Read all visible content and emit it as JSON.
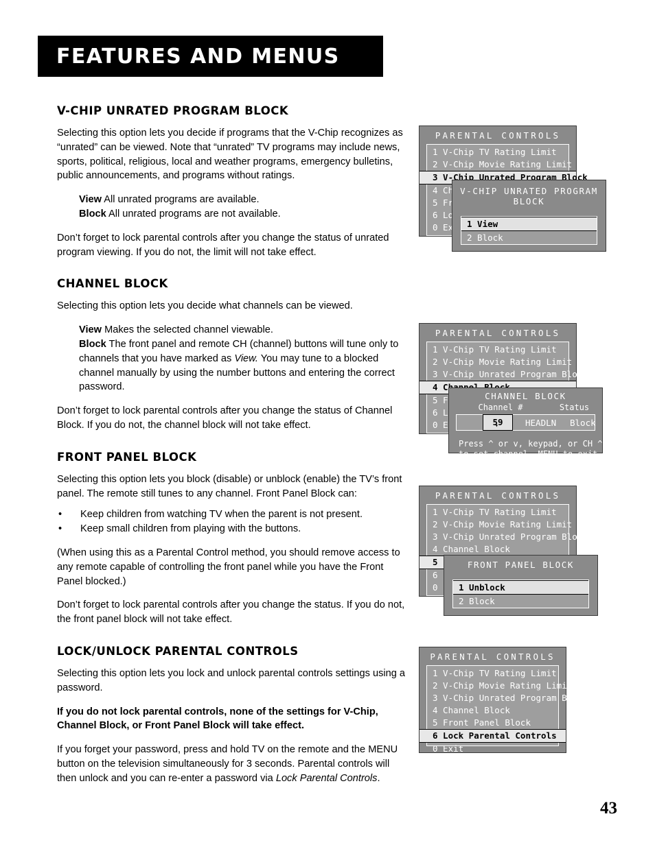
{
  "header": {
    "title": "FEATURES AND MENUS"
  },
  "page": {
    "number": "43"
  },
  "sections": {
    "vchip_unrated": {
      "heading": "V-CHIP UNRATED PROGRAM BLOCK",
      "intro": "Selecting this option lets you decide if programs that the V-Chip recognizes as “unrated” can be viewed. Note that “unrated” TV  programs may include news, sports, political, religious, local and weather programs, emergency bulletins, public announcements, and programs without ratings.",
      "view_term": "View",
      "view_desc": "All unrated programs are available.",
      "block_term": "Block",
      "block_desc": "All unrated programs are not available.",
      "outro": "Don’t forget to lock parental controls after you change the status of unrated program viewing. If you do not, the limit will not take effect."
    },
    "channel_block": {
      "heading": "CHANNEL BLOCK",
      "intro": "Selecting this option lets you decide what channels can be viewed.",
      "view_term": "View",
      "view_desc": "Makes the selected channel viewable.",
      "block_term": "Block",
      "block_desc_1": "The front panel and remote CH (channel) buttons will tune only to channels that you have marked as ",
      "block_desc_em": "View.",
      "block_desc_2": "  You may tune to a blocked channel manually by using the number buttons and entering the correct password.",
      "outro": "Don’t forget to lock parental controls after you change the status of Channel Block. If you do not, the channel block will not take effect."
    },
    "front_panel_block": {
      "heading": "FRONT PANEL BLOCK",
      "intro": "Selecting this option lets you block (disable) or unblock (enable) the TV’s front panel. The remote still tunes to any channel. Front Panel Block can:",
      "bullets": [
        "Keep children from watching TV when the parent is not present.",
        "Keep small children from playing with the buttons."
      ],
      "note": "(When using this as a Parental Control method, you should remove access to any remote capable of controlling the front panel while you have the Front Panel blocked.)",
      "outro": "Don’t forget to lock parental controls after you change the status. If you do not, the front panel block will not take effect."
    },
    "lock_unlock": {
      "heading": "LOCK/UNLOCK PARENTAL CONTROLS",
      "intro": "Selecting this option lets you lock and unlock parental controls settings using a password.",
      "bold_note": "If you do not lock parental controls, none of the settings for V-Chip, Channel Block, or Front Panel Block will take effect.",
      "outro_1": "If you forget your password, press and hold TV on the remote and the MENU button on the television simultaneously for 3 seconds. Parental controls will then unlock and you can re-enter a password via ",
      "outro_em": "Lock Parental Controls",
      "outro_2": "."
    }
  },
  "osd": {
    "parental_controls_title": "PARENTAL CONTROLS",
    "menu_items": [
      "1 V-Chip TV Rating Limit",
      "2 V-Chip Movie Rating Limit",
      "3 V-Chip Unrated Program Block",
      "4 Channel Block",
      "5 Front Panel Block",
      "6 Lock Parental Controls",
      "0 Exit"
    ],
    "graphic_1": {
      "selected_index": 2,
      "dialog": {
        "title": "V-CHIP UNRATED PROGRAM BLOCK",
        "options": [
          "1 View",
          "2 Block"
        ],
        "selected_index": 0
      }
    },
    "graphic_2": {
      "selected_index": 3,
      "dialog": {
        "title": "CHANNEL BLOCK",
        "head_channel": "Channel #",
        "head_status": "Status",
        "channel_number": "59",
        "channel_name": "HEADLN",
        "channel_status": "Block",
        "hint": "Press ^ or v, keypad, or CH ^/v\nto set channel, MENU to exit."
      }
    },
    "graphic_3": {
      "selected_index": 4,
      "dialog": {
        "title": "FRONT PANEL BLOCK",
        "options": [
          "1 Unblock",
          "2 Block"
        ],
        "selected_index": 0
      }
    },
    "graphic_4": {
      "selected_index": 5
    }
  },
  "colors": {
    "banner_bg": "#000000",
    "osd_panel": "#8a8a8a",
    "osd_list": "#9e9e9e",
    "osd_highlight": "#e8e8e8",
    "osd_text": "#ffffff"
  }
}
